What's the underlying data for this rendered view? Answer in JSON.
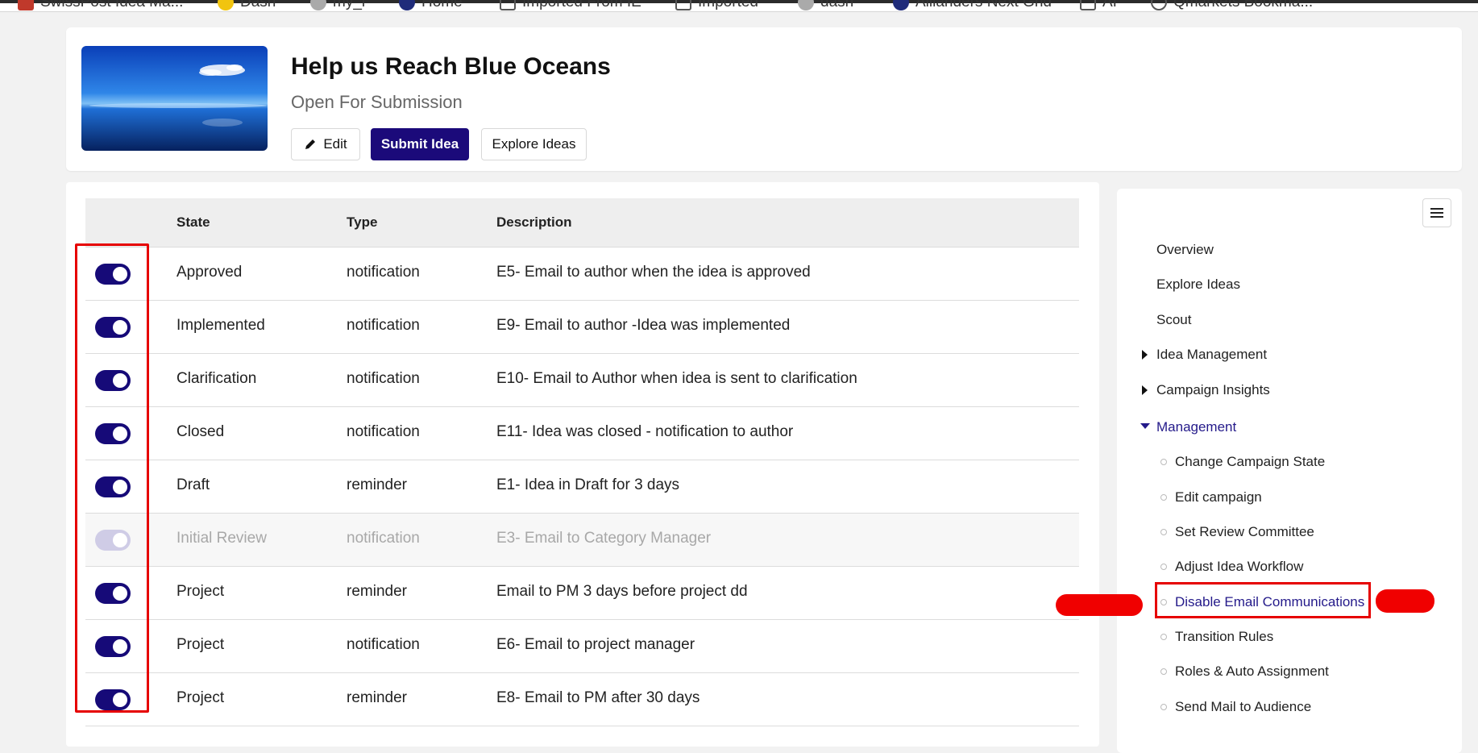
{
  "bookmarks": [
    {
      "label": "SwissPost Idea Ma...",
      "icon": "flag-icon",
      "color": "#c0392b"
    },
    {
      "label": "Dash",
      "icon": "dash-icon",
      "color": "#f1c40f"
    },
    {
      "label": "my_i",
      "icon": "globe-icon",
      "color": "#888888"
    },
    {
      "label": "Home",
      "icon": "home-logo-icon",
      "color": "#1f2b7a"
    },
    {
      "label": "Imported From IE",
      "icon": "folder-icon",
      "color": "#555555"
    },
    {
      "label": "Imported",
      "icon": "folder-icon",
      "color": "#555555"
    },
    {
      "label": "dash",
      "icon": "globe-icon",
      "color": "#888888"
    },
    {
      "label": "Allianders Next Gnd",
      "icon": "logo-icon",
      "color": "#1f2b7a"
    },
    {
      "label": "AI",
      "icon": "folder-icon",
      "color": "#555555"
    },
    {
      "label": "Qmarkets Bookma...",
      "icon": "globe-icon",
      "color": "#555555"
    }
  ],
  "header": {
    "title": "Help us Reach Blue Oceans",
    "status": "Open For Submission",
    "edit_label": "Edit",
    "submit_label": "Submit Idea",
    "explore_label": "Explore Ideas"
  },
  "table": {
    "columns": [
      "State",
      "Type",
      "Description"
    ],
    "rows": [
      {
        "enabled": true,
        "state": "Approved",
        "type": "notification",
        "description": "E5- Email to author when the idea is approved"
      },
      {
        "enabled": true,
        "state": "Implemented",
        "type": "notification",
        "description": "E9- Email to author -Idea was implemented"
      },
      {
        "enabled": true,
        "state": "Clarification",
        "type": "notification",
        "description": "E10- Email to Author when idea is sent to clarification"
      },
      {
        "enabled": true,
        "state": "Closed",
        "type": "notification",
        "description": "E11- Idea was closed - notification to author"
      },
      {
        "enabled": true,
        "state": "Draft",
        "type": "reminder",
        "description": "E1- Idea in Draft for 3 days"
      },
      {
        "enabled": false,
        "state": "Initial Review",
        "type": "notification",
        "description": "E3- Email to Category Manager"
      },
      {
        "enabled": true,
        "state": "Project",
        "type": "reminder",
        "description": "Email to PM 3 days before project dd"
      },
      {
        "enabled": true,
        "state": "Project",
        "type": "notification",
        "description": "E6- Email to project manager"
      },
      {
        "enabled": true,
        "state": "Project",
        "type": "reminder",
        "description": "E8- Email to PM after 30 days"
      }
    ]
  },
  "sidebar": {
    "top": [
      "Overview",
      "Explore Ideas",
      "Scout"
    ],
    "collapsed": [
      "Idea Management",
      "Campaign Insights"
    ],
    "expanded": "Management",
    "sub_items": [
      "Change Campaign State",
      "Edit campaign",
      "Set Review Committee",
      "Adjust Idea Workflow",
      "Disable Email Communications",
      "Transition Rules",
      "Roles & Auto Assignment",
      "Send Mail to Audience"
    ],
    "active_sub": "Disable Email Communications"
  },
  "colors": {
    "brand": "#1b0a7a",
    "toggle_on": "#160a78",
    "toggle_off": "#cfcce6",
    "highlight": "#e60000",
    "active_link": "#241a8a"
  }
}
